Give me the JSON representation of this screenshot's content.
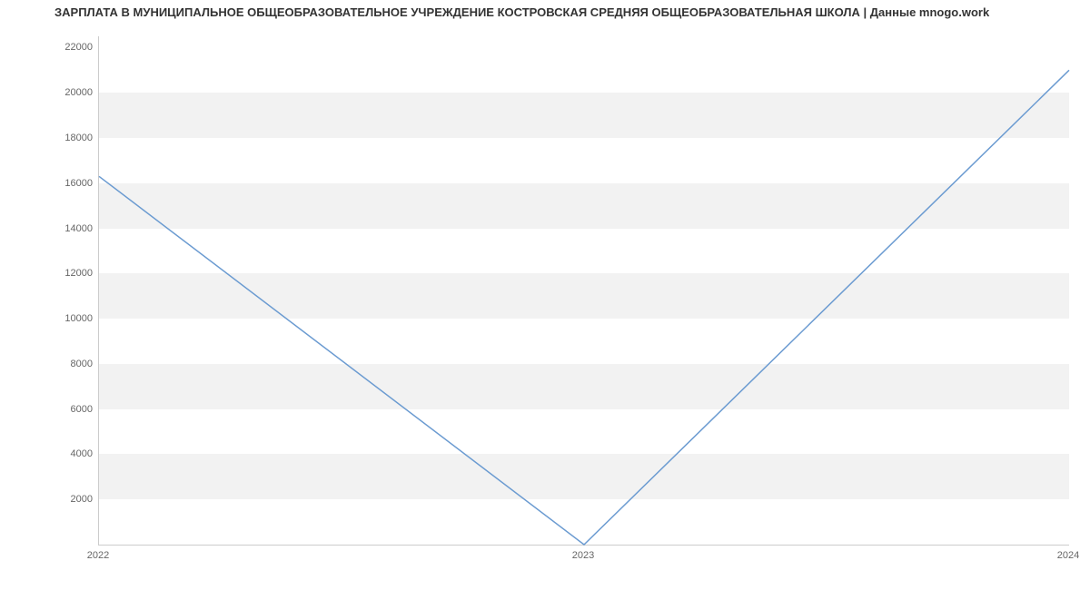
{
  "chart_data": {
    "type": "line",
    "title": "ЗАРПЛАТА В МУНИЦИПАЛЬНОЕ ОБЩЕОБРАЗОВАТЕЛЬНОЕ УЧРЕЖДЕНИЕ КОСТРОВСКАЯ СРЕДНЯЯ ОБЩЕОБРАЗОВАТЕЛЬНАЯ ШКОЛА | Данные mnogo.work",
    "x": [
      2022,
      2023,
      2024
    ],
    "values": [
      16300,
      0,
      21000
    ],
    "xlabel": "",
    "ylabel": "",
    "x_ticks": [
      2022,
      2023,
      2024
    ],
    "y_ticks": [
      2000,
      4000,
      6000,
      8000,
      10000,
      12000,
      14000,
      16000,
      18000,
      20000,
      22000
    ],
    "ylim": [
      0,
      22500
    ],
    "xlim": [
      2022,
      2024
    ],
    "line_color": "#6b9bd1",
    "grid": true
  }
}
